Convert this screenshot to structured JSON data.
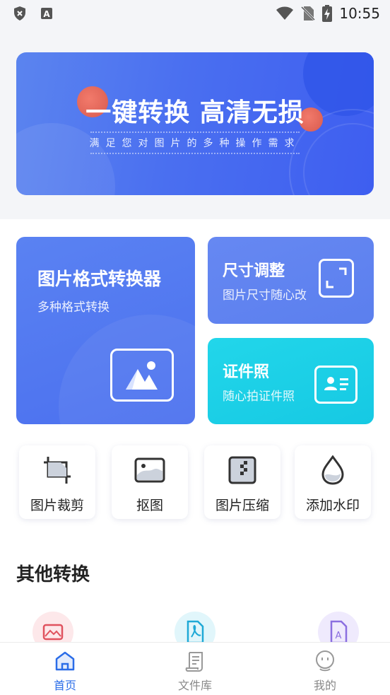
{
  "status_bar": {
    "time": "10:55",
    "icons": [
      "shield-x-icon",
      "a-icon",
      "wifi-icon",
      "no-sim-icon",
      "battery-charging-icon"
    ]
  },
  "banner": {
    "title": "一键转换  高清无损",
    "subtitle": "满足您对图片的多种操作需求"
  },
  "cards": {
    "format_converter": {
      "title": "图片格式转换器",
      "subtitle": "多种格式转换",
      "icon": "image-icon"
    },
    "resize": {
      "title": "尺寸调整",
      "subtitle": "图片尺寸随心改",
      "icon": "resize-frame-icon"
    },
    "id_photo": {
      "title": "证件照",
      "subtitle": "随心拍证件照",
      "icon": "id-card-icon"
    }
  },
  "tools": [
    {
      "label": "图片裁剪",
      "icon": "crop-icon"
    },
    {
      "label": "抠图",
      "icon": "cutout-image-icon"
    },
    {
      "label": "图片压缩",
      "icon": "compress-icon"
    },
    {
      "label": "添加水印",
      "icon": "watermark-drop-icon"
    }
  ],
  "other_section": {
    "title": "其他转换",
    "icons": [
      "image-convert-icon",
      "pdf-icon",
      "document-ai-icon"
    ]
  },
  "bottom_nav": {
    "items": [
      {
        "label": "首页",
        "icon": "home-icon",
        "active": true
      },
      {
        "label": "文件库",
        "icon": "file-library-icon",
        "active": false
      },
      {
        "label": "我的",
        "icon": "profile-icon",
        "active": false
      }
    ]
  },
  "colors": {
    "accent": "#2b6de8",
    "card_blue": "#4b70ef",
    "card_cyan": "#16c9e3",
    "banner_blue": "#3e5ef0"
  }
}
